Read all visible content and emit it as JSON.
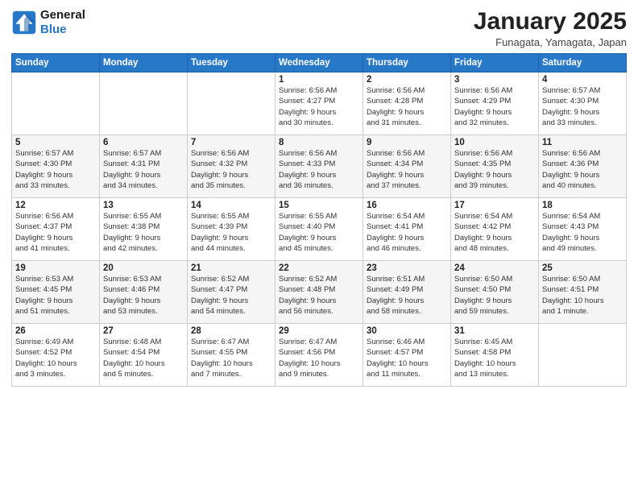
{
  "header": {
    "logo_line1": "General",
    "logo_line2": "Blue",
    "month": "January 2025",
    "location": "Funagata, Yamagata, Japan"
  },
  "weekdays": [
    "Sunday",
    "Monday",
    "Tuesday",
    "Wednesday",
    "Thursday",
    "Friday",
    "Saturday"
  ],
  "weeks": [
    [
      {
        "day": "",
        "info": ""
      },
      {
        "day": "",
        "info": ""
      },
      {
        "day": "",
        "info": ""
      },
      {
        "day": "1",
        "info": "Sunrise: 6:56 AM\nSunset: 4:27 PM\nDaylight: 9 hours\nand 30 minutes."
      },
      {
        "day": "2",
        "info": "Sunrise: 6:56 AM\nSunset: 4:28 PM\nDaylight: 9 hours\nand 31 minutes."
      },
      {
        "day": "3",
        "info": "Sunrise: 6:56 AM\nSunset: 4:29 PM\nDaylight: 9 hours\nand 32 minutes."
      },
      {
        "day": "4",
        "info": "Sunrise: 6:57 AM\nSunset: 4:30 PM\nDaylight: 9 hours\nand 33 minutes."
      }
    ],
    [
      {
        "day": "5",
        "info": "Sunrise: 6:57 AM\nSunset: 4:30 PM\nDaylight: 9 hours\nand 33 minutes."
      },
      {
        "day": "6",
        "info": "Sunrise: 6:57 AM\nSunset: 4:31 PM\nDaylight: 9 hours\nand 34 minutes."
      },
      {
        "day": "7",
        "info": "Sunrise: 6:56 AM\nSunset: 4:32 PM\nDaylight: 9 hours\nand 35 minutes."
      },
      {
        "day": "8",
        "info": "Sunrise: 6:56 AM\nSunset: 4:33 PM\nDaylight: 9 hours\nand 36 minutes."
      },
      {
        "day": "9",
        "info": "Sunrise: 6:56 AM\nSunset: 4:34 PM\nDaylight: 9 hours\nand 37 minutes."
      },
      {
        "day": "10",
        "info": "Sunrise: 6:56 AM\nSunset: 4:35 PM\nDaylight: 9 hours\nand 39 minutes."
      },
      {
        "day": "11",
        "info": "Sunrise: 6:56 AM\nSunset: 4:36 PM\nDaylight: 9 hours\nand 40 minutes."
      }
    ],
    [
      {
        "day": "12",
        "info": "Sunrise: 6:56 AM\nSunset: 4:37 PM\nDaylight: 9 hours\nand 41 minutes."
      },
      {
        "day": "13",
        "info": "Sunrise: 6:55 AM\nSunset: 4:38 PM\nDaylight: 9 hours\nand 42 minutes."
      },
      {
        "day": "14",
        "info": "Sunrise: 6:55 AM\nSunset: 4:39 PM\nDaylight: 9 hours\nand 44 minutes."
      },
      {
        "day": "15",
        "info": "Sunrise: 6:55 AM\nSunset: 4:40 PM\nDaylight: 9 hours\nand 45 minutes."
      },
      {
        "day": "16",
        "info": "Sunrise: 6:54 AM\nSunset: 4:41 PM\nDaylight: 9 hours\nand 46 minutes."
      },
      {
        "day": "17",
        "info": "Sunrise: 6:54 AM\nSunset: 4:42 PM\nDaylight: 9 hours\nand 48 minutes."
      },
      {
        "day": "18",
        "info": "Sunrise: 6:54 AM\nSunset: 4:43 PM\nDaylight: 9 hours\nand 49 minutes."
      }
    ],
    [
      {
        "day": "19",
        "info": "Sunrise: 6:53 AM\nSunset: 4:45 PM\nDaylight: 9 hours\nand 51 minutes."
      },
      {
        "day": "20",
        "info": "Sunrise: 6:53 AM\nSunset: 4:46 PM\nDaylight: 9 hours\nand 53 minutes."
      },
      {
        "day": "21",
        "info": "Sunrise: 6:52 AM\nSunset: 4:47 PM\nDaylight: 9 hours\nand 54 minutes."
      },
      {
        "day": "22",
        "info": "Sunrise: 6:52 AM\nSunset: 4:48 PM\nDaylight: 9 hours\nand 56 minutes."
      },
      {
        "day": "23",
        "info": "Sunrise: 6:51 AM\nSunset: 4:49 PM\nDaylight: 9 hours\nand 58 minutes."
      },
      {
        "day": "24",
        "info": "Sunrise: 6:50 AM\nSunset: 4:50 PM\nDaylight: 9 hours\nand 59 minutes."
      },
      {
        "day": "25",
        "info": "Sunrise: 6:50 AM\nSunset: 4:51 PM\nDaylight: 10 hours\nand 1 minute."
      }
    ],
    [
      {
        "day": "26",
        "info": "Sunrise: 6:49 AM\nSunset: 4:52 PM\nDaylight: 10 hours\nand 3 minutes."
      },
      {
        "day": "27",
        "info": "Sunrise: 6:48 AM\nSunset: 4:54 PM\nDaylight: 10 hours\nand 5 minutes."
      },
      {
        "day": "28",
        "info": "Sunrise: 6:47 AM\nSunset: 4:55 PM\nDaylight: 10 hours\nand 7 minutes."
      },
      {
        "day": "29",
        "info": "Sunrise: 6:47 AM\nSunset: 4:56 PM\nDaylight: 10 hours\nand 9 minutes."
      },
      {
        "day": "30",
        "info": "Sunrise: 6:46 AM\nSunset: 4:57 PM\nDaylight: 10 hours\nand 11 minutes."
      },
      {
        "day": "31",
        "info": "Sunrise: 6:45 AM\nSunset: 4:58 PM\nDaylight: 10 hours\nand 13 minutes."
      },
      {
        "day": "",
        "info": ""
      }
    ]
  ]
}
